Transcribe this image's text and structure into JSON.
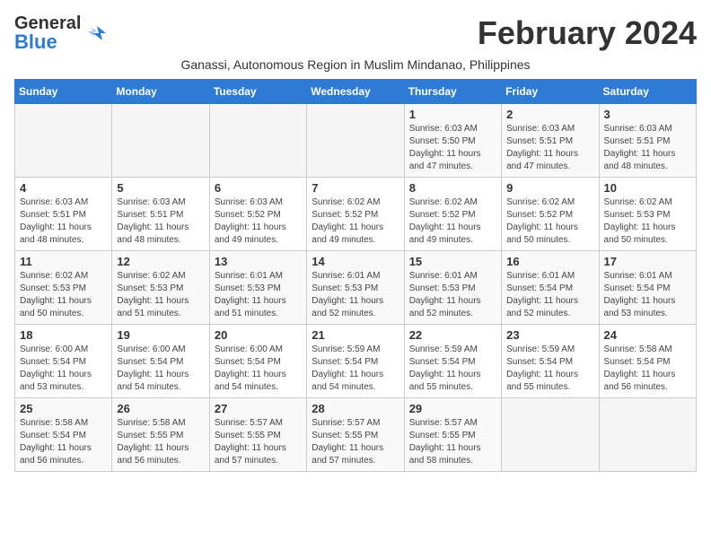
{
  "header": {
    "logo_general": "General",
    "logo_blue": "Blue",
    "month_title": "February 2024",
    "subtitle": "Ganassi, Autonomous Region in Muslim Mindanao, Philippines"
  },
  "weekdays": [
    "Sunday",
    "Monday",
    "Tuesday",
    "Wednesday",
    "Thursday",
    "Friday",
    "Saturday"
  ],
  "weeks": [
    [
      {
        "day": "",
        "sunrise": "",
        "sunset": "",
        "daylight": ""
      },
      {
        "day": "",
        "sunrise": "",
        "sunset": "",
        "daylight": ""
      },
      {
        "day": "",
        "sunrise": "",
        "sunset": "",
        "daylight": ""
      },
      {
        "day": "",
        "sunrise": "",
        "sunset": "",
        "daylight": ""
      },
      {
        "day": "1",
        "sunrise": "Sunrise: 6:03 AM",
        "sunset": "Sunset: 5:50 PM",
        "daylight": "Daylight: 11 hours and 47 minutes."
      },
      {
        "day": "2",
        "sunrise": "Sunrise: 6:03 AM",
        "sunset": "Sunset: 5:51 PM",
        "daylight": "Daylight: 11 hours and 47 minutes."
      },
      {
        "day": "3",
        "sunrise": "Sunrise: 6:03 AM",
        "sunset": "Sunset: 5:51 PM",
        "daylight": "Daylight: 11 hours and 48 minutes."
      }
    ],
    [
      {
        "day": "4",
        "sunrise": "Sunrise: 6:03 AM",
        "sunset": "Sunset: 5:51 PM",
        "daylight": "Daylight: 11 hours and 48 minutes."
      },
      {
        "day": "5",
        "sunrise": "Sunrise: 6:03 AM",
        "sunset": "Sunset: 5:51 PM",
        "daylight": "Daylight: 11 hours and 48 minutes."
      },
      {
        "day": "6",
        "sunrise": "Sunrise: 6:03 AM",
        "sunset": "Sunset: 5:52 PM",
        "daylight": "Daylight: 11 hours and 49 minutes."
      },
      {
        "day": "7",
        "sunrise": "Sunrise: 6:02 AM",
        "sunset": "Sunset: 5:52 PM",
        "daylight": "Daylight: 11 hours and 49 minutes."
      },
      {
        "day": "8",
        "sunrise": "Sunrise: 6:02 AM",
        "sunset": "Sunset: 5:52 PM",
        "daylight": "Daylight: 11 hours and 49 minutes."
      },
      {
        "day": "9",
        "sunrise": "Sunrise: 6:02 AM",
        "sunset": "Sunset: 5:52 PM",
        "daylight": "Daylight: 11 hours and 50 minutes."
      },
      {
        "day": "10",
        "sunrise": "Sunrise: 6:02 AM",
        "sunset": "Sunset: 5:53 PM",
        "daylight": "Daylight: 11 hours and 50 minutes."
      }
    ],
    [
      {
        "day": "11",
        "sunrise": "Sunrise: 6:02 AM",
        "sunset": "Sunset: 5:53 PM",
        "daylight": "Daylight: 11 hours and 50 minutes."
      },
      {
        "day": "12",
        "sunrise": "Sunrise: 6:02 AM",
        "sunset": "Sunset: 5:53 PM",
        "daylight": "Daylight: 11 hours and 51 minutes."
      },
      {
        "day": "13",
        "sunrise": "Sunrise: 6:01 AM",
        "sunset": "Sunset: 5:53 PM",
        "daylight": "Daylight: 11 hours and 51 minutes."
      },
      {
        "day": "14",
        "sunrise": "Sunrise: 6:01 AM",
        "sunset": "Sunset: 5:53 PM",
        "daylight": "Daylight: 11 hours and 52 minutes."
      },
      {
        "day": "15",
        "sunrise": "Sunrise: 6:01 AM",
        "sunset": "Sunset: 5:53 PM",
        "daylight": "Daylight: 11 hours and 52 minutes."
      },
      {
        "day": "16",
        "sunrise": "Sunrise: 6:01 AM",
        "sunset": "Sunset: 5:54 PM",
        "daylight": "Daylight: 11 hours and 52 minutes."
      },
      {
        "day": "17",
        "sunrise": "Sunrise: 6:01 AM",
        "sunset": "Sunset: 5:54 PM",
        "daylight": "Daylight: 11 hours and 53 minutes."
      }
    ],
    [
      {
        "day": "18",
        "sunrise": "Sunrise: 6:00 AM",
        "sunset": "Sunset: 5:54 PM",
        "daylight": "Daylight: 11 hours and 53 minutes."
      },
      {
        "day": "19",
        "sunrise": "Sunrise: 6:00 AM",
        "sunset": "Sunset: 5:54 PM",
        "daylight": "Daylight: 11 hours and 54 minutes."
      },
      {
        "day": "20",
        "sunrise": "Sunrise: 6:00 AM",
        "sunset": "Sunset: 5:54 PM",
        "daylight": "Daylight: 11 hours and 54 minutes."
      },
      {
        "day": "21",
        "sunrise": "Sunrise: 5:59 AM",
        "sunset": "Sunset: 5:54 PM",
        "daylight": "Daylight: 11 hours and 54 minutes."
      },
      {
        "day": "22",
        "sunrise": "Sunrise: 5:59 AM",
        "sunset": "Sunset: 5:54 PM",
        "daylight": "Daylight: 11 hours and 55 minutes."
      },
      {
        "day": "23",
        "sunrise": "Sunrise: 5:59 AM",
        "sunset": "Sunset: 5:54 PM",
        "daylight": "Daylight: 11 hours and 55 minutes."
      },
      {
        "day": "24",
        "sunrise": "Sunrise: 5:58 AM",
        "sunset": "Sunset: 5:54 PM",
        "daylight": "Daylight: 11 hours and 56 minutes."
      }
    ],
    [
      {
        "day": "25",
        "sunrise": "Sunrise: 5:58 AM",
        "sunset": "Sunset: 5:54 PM",
        "daylight": "Daylight: 11 hours and 56 minutes."
      },
      {
        "day": "26",
        "sunrise": "Sunrise: 5:58 AM",
        "sunset": "Sunset: 5:55 PM",
        "daylight": "Daylight: 11 hours and 56 minutes."
      },
      {
        "day": "27",
        "sunrise": "Sunrise: 5:57 AM",
        "sunset": "Sunset: 5:55 PM",
        "daylight": "Daylight: 11 hours and 57 minutes."
      },
      {
        "day": "28",
        "sunrise": "Sunrise: 5:57 AM",
        "sunset": "Sunset: 5:55 PM",
        "daylight": "Daylight: 11 hours and 57 minutes."
      },
      {
        "day": "29",
        "sunrise": "Sunrise: 5:57 AM",
        "sunset": "Sunset: 5:55 PM",
        "daylight": "Daylight: 11 hours and 58 minutes."
      },
      {
        "day": "",
        "sunrise": "",
        "sunset": "",
        "daylight": ""
      },
      {
        "day": "",
        "sunrise": "",
        "sunset": "",
        "daylight": ""
      }
    ]
  ]
}
